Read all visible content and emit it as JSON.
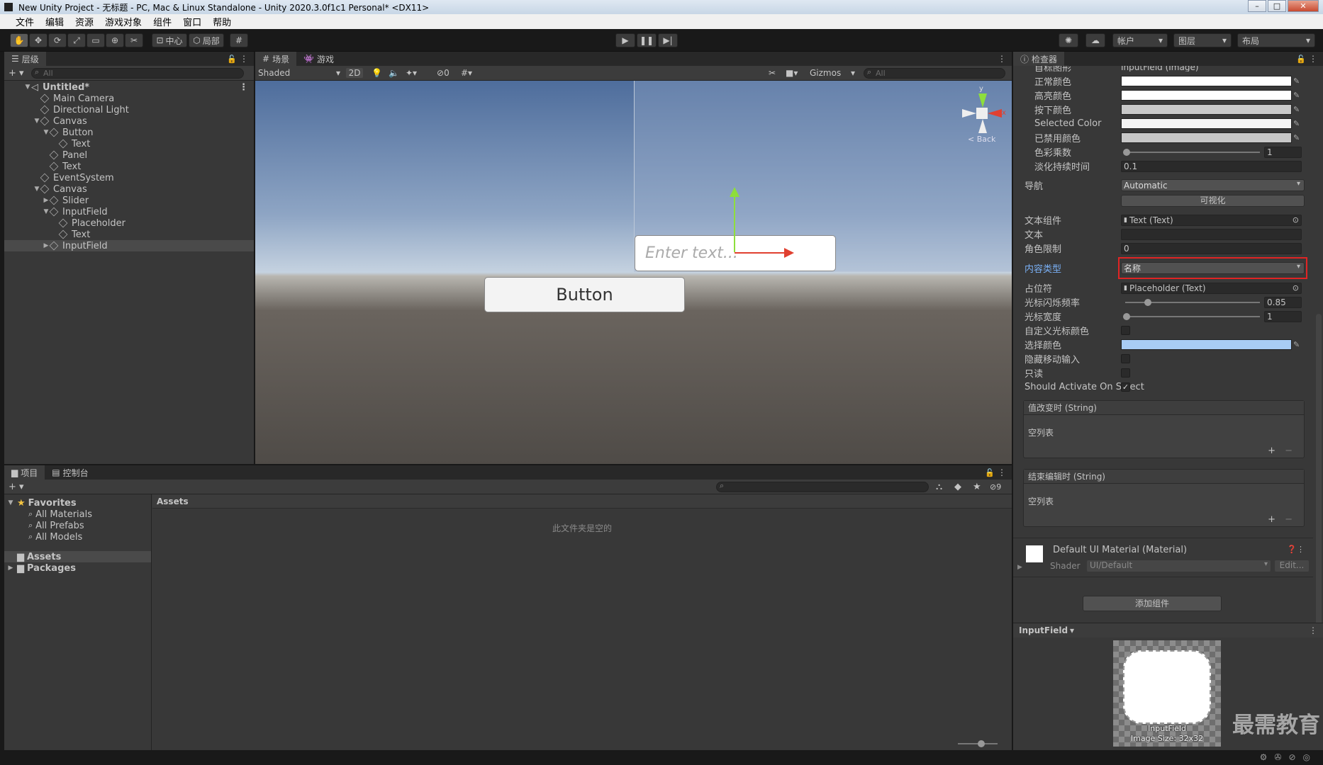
{
  "window": {
    "title": "New Unity Project - 无标题 - PC, Mac & Linux Standalone - Unity 2020.3.0f1c1 Personal* <DX11>",
    "minimize": "–",
    "maximize": "□",
    "close": "✕"
  },
  "menu": [
    "文件",
    "编辑",
    "资源",
    "游戏对象",
    "组件",
    "窗口",
    "帮助"
  ],
  "toolbar": {
    "pivot_label": "中心",
    "local_label": "局部",
    "account_label": "帐户",
    "layers_label": "图层",
    "layout_label": "布局"
  },
  "hierarchy": {
    "tab": "层级",
    "search_placeholder": "All",
    "add": "+",
    "rows": [
      {
        "label": "Untitled*",
        "depth": 0,
        "expanded": true,
        "scene": true
      },
      {
        "label": "Main Camera",
        "depth": 1
      },
      {
        "label": "Directional Light",
        "depth": 1
      },
      {
        "label": "Canvas",
        "depth": 1,
        "expanded": true
      },
      {
        "label": "Button",
        "depth": 2,
        "expanded": true
      },
      {
        "label": "Text",
        "depth": 3
      },
      {
        "label": "Panel",
        "depth": 2
      },
      {
        "label": "Text",
        "depth": 2
      },
      {
        "label": "EventSystem",
        "depth": 1
      },
      {
        "label": "Canvas",
        "depth": 1,
        "expanded": true
      },
      {
        "label": "Slider",
        "depth": 2,
        "collapsed": true
      },
      {
        "label": "InputField",
        "depth": 2,
        "expanded": true
      },
      {
        "label": "Placeholder",
        "depth": 3
      },
      {
        "label": "Text",
        "depth": 3
      },
      {
        "label": "InputField",
        "depth": 2,
        "collapsed": true,
        "selected": true
      }
    ]
  },
  "scene": {
    "tab_scene": "场景",
    "tab_game": "游戏",
    "shading": "Shaded",
    "mode_2d": "2D",
    "hidden_count": "0",
    "gizmos": "Gizmos",
    "search_placeholder": "All",
    "axis_y": "y",
    "axis_x": "x",
    "back": "< Back",
    "input_placeholder": "Enter text...",
    "button_label": "Button"
  },
  "project": {
    "tab_project": "项目",
    "tab_console": "控制台",
    "add": "+",
    "favorites": "Favorites",
    "favorite_items": [
      "All Materials",
      "All Prefabs",
      "All Models"
    ],
    "assets": "Assets",
    "packages": "Packages",
    "breadcrumb": "Assets",
    "empty_message": "此文件夹是空的",
    "hidden_count": "9"
  },
  "inspector": {
    "tab": "检查器",
    "cut_label": "目标图形",
    "cut_value": "InputField (Image)",
    "normal_color": "正常颜色",
    "highlight_color": "高亮颜色",
    "pressed_color": "按下颜色",
    "selected_color": "Selected Color",
    "disabled_color": "已禁用颜色",
    "color_multiplier": "色彩乘数",
    "color_multiplier_value": "1",
    "fade_duration": "淡化持续时间",
    "fade_duration_value": "0.1",
    "navigation": "导航",
    "navigation_value": "Automatic",
    "visualize": "可视化",
    "text_component": "文本组件",
    "text_component_value": "Text (Text)",
    "text": "文本",
    "text_value": "",
    "char_limit": "角色限制",
    "char_limit_value": "0",
    "content_type": "内容类型",
    "content_type_value": "名称",
    "placeholder": "占位符",
    "placeholder_value": "Placeholder (Text)",
    "caret_blink": "光标闪烁频率",
    "caret_blink_value": "0.85",
    "caret_blink_level": 0.17,
    "caret_width": "光标宽度",
    "caret_width_value": "1",
    "custom_caret": "自定义光标颜色",
    "selection_color": "选择颜色",
    "hide_mobile": "隐藏移动输入",
    "read_only": "只读",
    "activate_on_select": "Should Activate On Select",
    "on_value_changed": "值改变时 (String)",
    "on_end_edit": "结束编辑时 (String)",
    "empty_list": "空列表",
    "plus": "+",
    "minus": "−",
    "material_name": "Default UI Material (Material)",
    "shader_label": "Shader",
    "shader_value": "UI/Default",
    "edit": "Edit...",
    "add_component": "添加组件",
    "preview_title": "InputField",
    "preview_caption": "InputField",
    "preview_size": "Image Size: 32x32"
  },
  "watermark": "最需教育",
  "colors": {
    "highlight_box": "#e02424",
    "selection_color": "#a8ccf5",
    "sky_top": "#4c6ea0",
    "ground": "#5a5550"
  }
}
